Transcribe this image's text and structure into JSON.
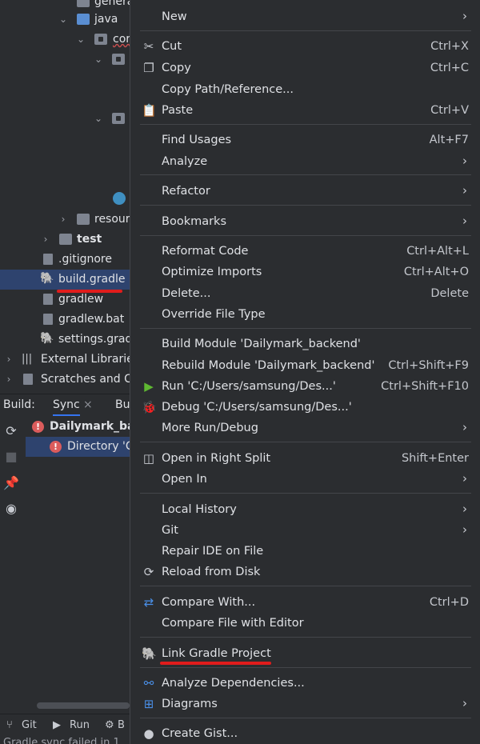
{
  "project_tree": {
    "items": [
      {
        "label": "genera"
      },
      {
        "label": "java"
      },
      {
        "label": "cor"
      },
      {
        "label": "resour"
      },
      {
        "label": "test"
      },
      {
        "label": ".gitignore"
      },
      {
        "label": "build.gradle"
      },
      {
        "label": "gradlew"
      },
      {
        "label": "gradlew.bat"
      },
      {
        "label": "settings.grad"
      },
      {
        "label": "External Librarie"
      },
      {
        "label": "Scratches and C"
      }
    ]
  },
  "build_panel": {
    "title": "Build:",
    "tab_sync": "Sync",
    "tab_close": "×",
    "tab_other": "Bu",
    "rows": [
      {
        "label": "Dailymark_bac"
      },
      {
        "label": "Directory 'C"
      }
    ]
  },
  "status_bar": {
    "git": "Git",
    "run": "Run",
    "other": "B",
    "bottom_text": "Gradle sync failed in 1"
  },
  "menu": {
    "items": [
      {
        "label": "New",
        "shortcut": "",
        "submenu": true,
        "icon": ""
      },
      {
        "label": "Cut",
        "shortcut": "Ctrl+X",
        "submenu": false,
        "icon": "scissors-icon"
      },
      {
        "label": "Copy",
        "shortcut": "Ctrl+C",
        "submenu": false,
        "icon": "copy-icon"
      },
      {
        "label": "Copy Path/Reference...",
        "shortcut": "",
        "submenu": false,
        "icon": ""
      },
      {
        "label": "Paste",
        "shortcut": "Ctrl+V",
        "submenu": false,
        "icon": "paste-icon"
      },
      {
        "label": "Find Usages",
        "shortcut": "Alt+F7",
        "submenu": false,
        "icon": ""
      },
      {
        "label": "Analyze",
        "shortcut": "",
        "submenu": true,
        "icon": ""
      },
      {
        "label": "Refactor",
        "shortcut": "",
        "submenu": true,
        "icon": ""
      },
      {
        "label": "Bookmarks",
        "shortcut": "",
        "submenu": true,
        "icon": ""
      },
      {
        "label": "Reformat Code",
        "shortcut": "Ctrl+Alt+L",
        "submenu": false,
        "icon": ""
      },
      {
        "label": "Optimize Imports",
        "shortcut": "Ctrl+Alt+O",
        "submenu": false,
        "icon": ""
      },
      {
        "label": "Delete...",
        "shortcut": "Delete",
        "submenu": false,
        "icon": ""
      },
      {
        "label": "Override File Type",
        "shortcut": "",
        "submenu": false,
        "icon": ""
      },
      {
        "label": "Build Module 'Dailymark_backend'",
        "shortcut": "",
        "submenu": false,
        "icon": ""
      },
      {
        "label": "Rebuild Module 'Dailymark_backend'",
        "shortcut": "Ctrl+Shift+F9",
        "submenu": false,
        "icon": ""
      },
      {
        "label": "Run 'C:/Users/samsung/Des...'",
        "shortcut": "Ctrl+Shift+F10",
        "submenu": false,
        "icon": "run-icon"
      },
      {
        "label": "Debug 'C:/Users/samsung/Des...'",
        "shortcut": "",
        "submenu": false,
        "icon": "debug-icon"
      },
      {
        "label": "More Run/Debug",
        "shortcut": "",
        "submenu": true,
        "icon": ""
      },
      {
        "label": "Open in Right Split",
        "shortcut": "Shift+Enter",
        "submenu": false,
        "icon": "split-icon"
      },
      {
        "label": "Open In",
        "shortcut": "",
        "submenu": true,
        "icon": ""
      },
      {
        "label": "Local History",
        "shortcut": "",
        "submenu": true,
        "icon": ""
      },
      {
        "label": "Git",
        "shortcut": "",
        "submenu": true,
        "icon": ""
      },
      {
        "label": "Repair IDE on File",
        "shortcut": "",
        "submenu": false,
        "icon": ""
      },
      {
        "label": "Reload from Disk",
        "shortcut": "",
        "submenu": false,
        "icon": "reload-icon"
      },
      {
        "label": "Compare With...",
        "shortcut": "Ctrl+D",
        "submenu": false,
        "icon": "compare-icon"
      },
      {
        "label": "Compare File with Editor",
        "shortcut": "",
        "submenu": false,
        "icon": ""
      },
      {
        "label": "Link Gradle Project",
        "shortcut": "",
        "submenu": false,
        "icon": "gradle-icon"
      },
      {
        "label": "Analyze Dependencies...",
        "shortcut": "",
        "submenu": false,
        "icon": "dependencies-icon"
      },
      {
        "label": "Diagrams",
        "shortcut": "",
        "submenu": true,
        "icon": "diagrams-icon"
      },
      {
        "label": "Create Gist...",
        "shortcut": "",
        "submenu": false,
        "icon": "github-icon"
      }
    ],
    "submenu_arrow": "›"
  },
  "colors": {
    "background": "#2b2d30",
    "selection": "#2e436e",
    "separator": "#43454a",
    "annotation_red": "#e01c1c",
    "run_green": "#5fb832",
    "error_red": "#db5c5c"
  }
}
